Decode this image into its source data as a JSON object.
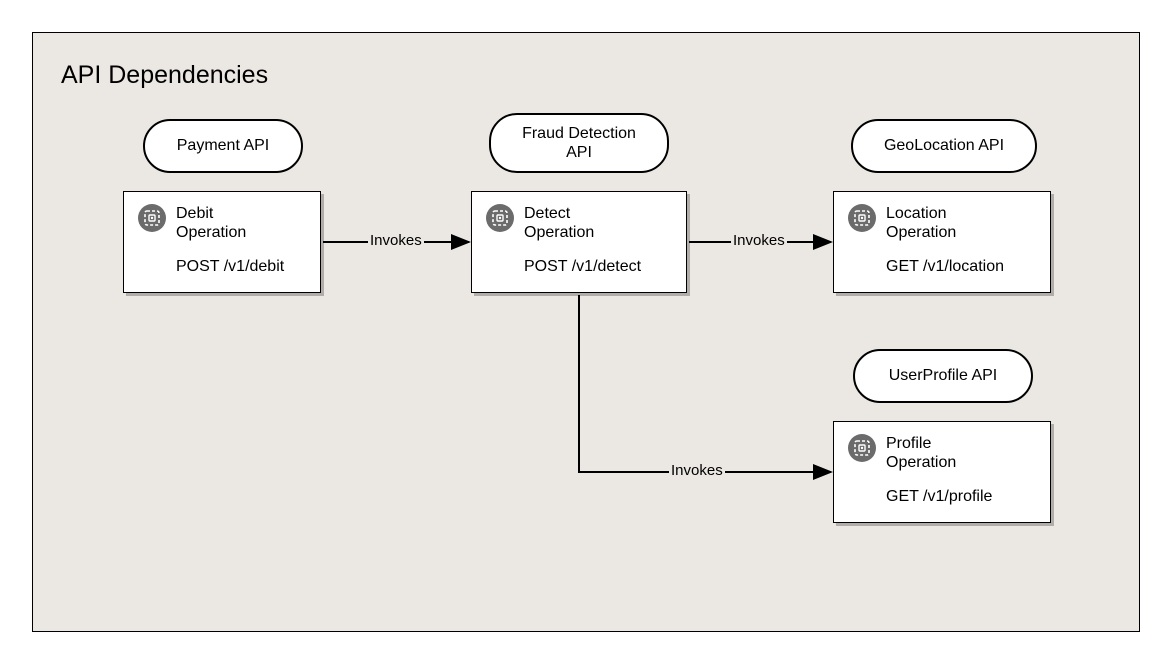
{
  "title": "API Dependencies",
  "apis": {
    "payment": {
      "label": "Payment API"
    },
    "fraud": {
      "label": "Fraud Detection API"
    },
    "geo": {
      "label": "GeoLocation API"
    },
    "profile": {
      "label": "UserProfile API"
    }
  },
  "ops": {
    "debit": {
      "name_line1": "Debit",
      "name_line2": "Operation",
      "endpoint": "POST /v1/debit"
    },
    "detect": {
      "name_line1": "Detect",
      "name_line2": "Operation",
      "endpoint": "POST /v1/detect"
    },
    "location": {
      "name_line1": "Location",
      "name_line2": "Operation",
      "endpoint": "GET /v1/location"
    },
    "profile": {
      "name_line1": "Profile",
      "name_line2": "Operation",
      "endpoint": "GET /v1/profile"
    }
  },
  "edges": {
    "e1": {
      "label": "Invokes"
    },
    "e2": {
      "label": "Invokes"
    },
    "e3": {
      "label": "Invokes"
    }
  }
}
